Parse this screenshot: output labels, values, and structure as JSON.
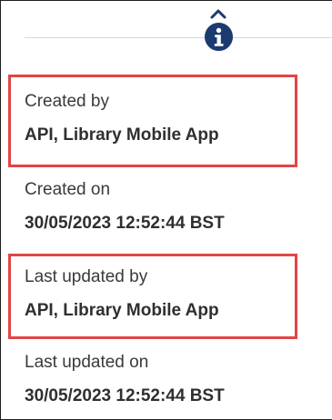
{
  "details": {
    "fields": [
      {
        "label": "Created by",
        "value": "API, Library Mobile App"
      },
      {
        "label": "Created on",
        "value": "30/05/2023 12:52:44 BST"
      },
      {
        "label": "Last updated by",
        "value": "API, Library Mobile App"
      },
      {
        "label": "Last updated on",
        "value": "30/05/2023 12:52:44 BST"
      }
    ]
  },
  "icons": {
    "collapse": "chevron-up-icon",
    "info": "info-icon"
  },
  "colors": {
    "info_icon_bg": "#1a3a70",
    "highlight_border": "#e14545",
    "label_text": "#3a3a3a",
    "value_text": "#2f2f2f"
  }
}
